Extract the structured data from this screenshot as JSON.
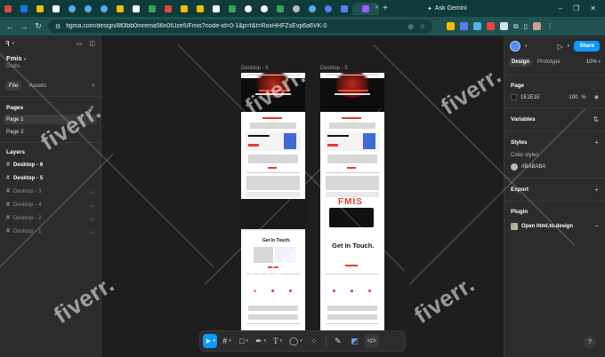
{
  "browser": {
    "gemini_label": "Ask Gemini",
    "url": "figma.com/design/8f0lbb0mrema56n0tUze5/Fmis?node-id=0-1&p=f&t=RoxHHFZsEvp6a6VK-0"
  },
  "file": {
    "name": "Fmis",
    "location": "Drafts"
  },
  "left_panel": {
    "tab_file": "File",
    "tab_assets": "Assets",
    "pages_heading": "Pages",
    "pages": [
      "Page 1",
      "Page 2"
    ],
    "layers_heading": "Layers",
    "layers": [
      "Desktop - 6",
      "Desktop - 5",
      "Desktop - 3",
      "Desktop - 4",
      "Desktop - 2",
      "Desktop - 1"
    ]
  },
  "canvas": {
    "frame_labels": [
      "Desktop - 6",
      "Desktop - 5"
    ],
    "frame_text": {
      "get_in_touch": "Get In Touch.",
      "brand": "FMIS"
    }
  },
  "right_panel": {
    "tab_design": "Design",
    "tab_prototype": "Prototype",
    "zoom": "10%",
    "share": "Share",
    "page_heading": "Page",
    "page_color": "1E1E1E",
    "page_opacity": "100",
    "percent_sign": "%",
    "variables_heading": "Variables",
    "styles_heading": "Styles",
    "color_styles_label": "Color styles",
    "color_style_name": "#BABABA",
    "export_heading": "Export",
    "plugin_heading": "Plugin",
    "plugin_name": "Open html.to.design",
    "help": "?"
  },
  "watermark": "fiverr."
}
